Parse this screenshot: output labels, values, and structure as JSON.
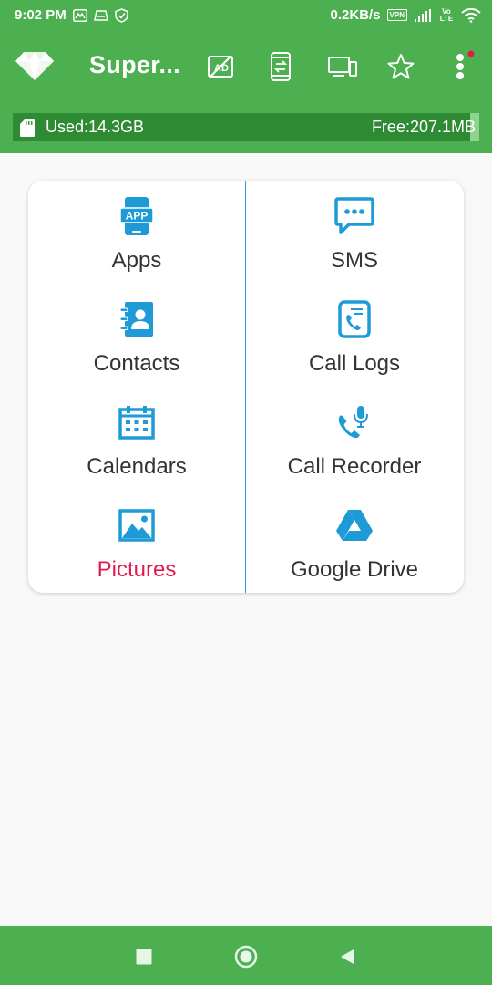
{
  "status_bar": {
    "time": "9:02 PM",
    "speed": "0.2KB/s",
    "vpn": "VPN",
    "lte": "Vo LTE"
  },
  "app_bar": {
    "title": "Super...",
    "icons": [
      "diamond-logo",
      "no-ads-icon",
      "phone-transfer-icon",
      "devices-icon",
      "star-icon",
      "more-vert-icon"
    ],
    "notification_dot_color": "#e5184b"
  },
  "storage": {
    "used_label": "Used:14.3GB",
    "free_label": "Free:207.1MB",
    "used_fraction": 0.986
  },
  "grid": {
    "items": [
      {
        "label": "Apps",
        "icon": "apps-icon"
      },
      {
        "label": "SMS",
        "icon": "sms-icon"
      },
      {
        "label": "Contacts",
        "icon": "contacts-icon"
      },
      {
        "label": "Call Logs",
        "icon": "call-logs-icon"
      },
      {
        "label": "Calendars",
        "icon": "calendar-icon"
      },
      {
        "label": "Call Recorder",
        "icon": "call-recorder-icon"
      },
      {
        "label": "Pictures",
        "icon": "pictures-icon"
      },
      {
        "label": "Google Drive",
        "icon": "google-drive-icon"
      }
    ],
    "app_icon_text": "APP",
    "icon_color": "#1e9bd7",
    "highlight_color": "#e5184b"
  },
  "colors": {
    "primary": "#4caf50",
    "divider": "#2f9bd8"
  }
}
